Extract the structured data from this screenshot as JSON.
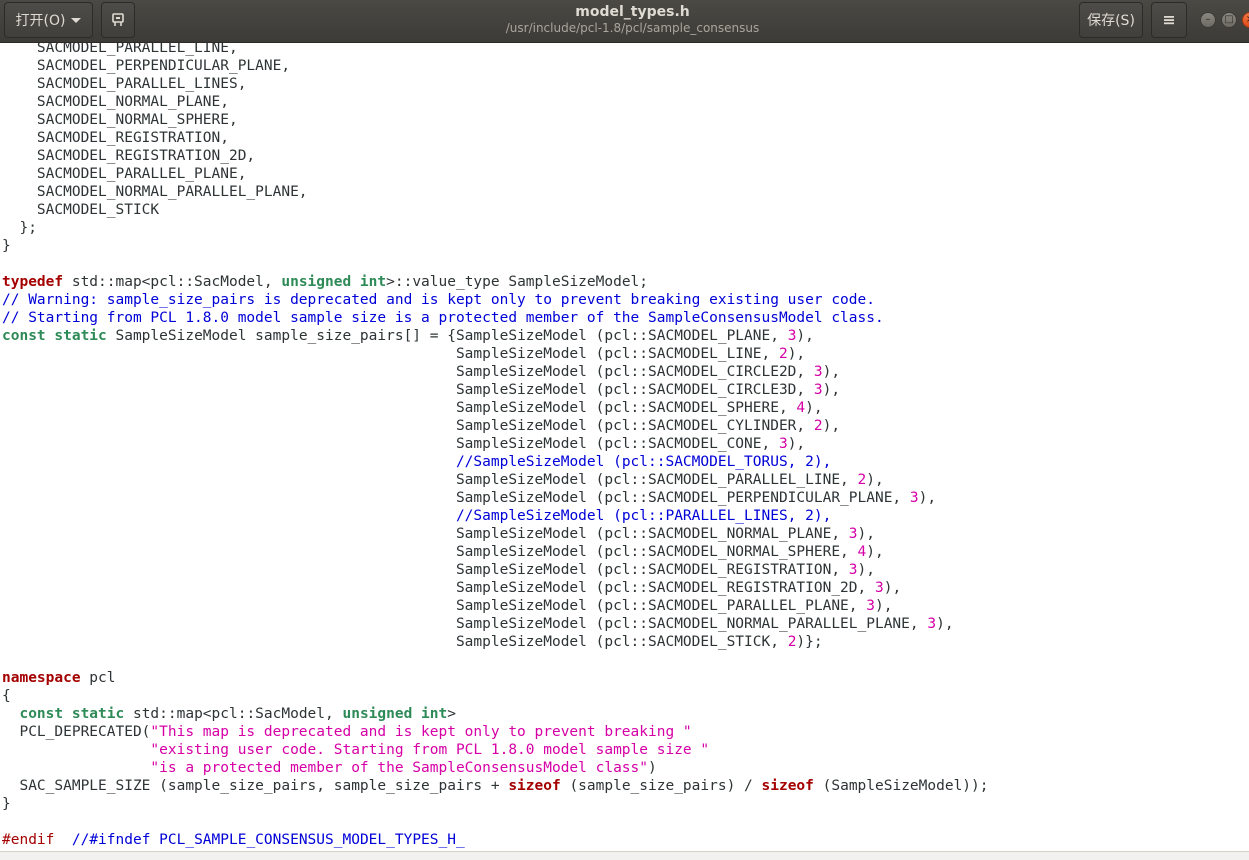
{
  "header": {
    "open_label": "打开(O)",
    "save_label": "保存(S)",
    "title": "model_types.h",
    "subtitle": "/usr/include/pcl-1.8/pcl/sample_consensus"
  },
  "colors": {
    "keyword": "#a40000",
    "type": "#2e8b57",
    "comment": "#0000d8",
    "string": "#d600a6",
    "text": "#2e3436",
    "headerbar": "#3c3b37"
  },
  "icons": {
    "open_dropdown": "chevron-down-icon",
    "pin": "pin-icon",
    "menu": "hamburger-menu-icon",
    "minimize": "minimize-icon",
    "maximize": "maximize-icon",
    "close": "close-icon"
  },
  "code_lines": [
    [
      [
        "",
        "    SACMODEL_PARALLEL_LINE,"
      ]
    ],
    [
      [
        "",
        "    SACMODEL_PERPENDICULAR_PLANE,"
      ]
    ],
    [
      [
        "",
        "    SACMODEL_PARALLEL_LINES,"
      ]
    ],
    [
      [
        "",
        "    SACMODEL_NORMAL_PLANE,"
      ]
    ],
    [
      [
        "",
        "    SACMODEL_NORMAL_SPHERE,"
      ]
    ],
    [
      [
        "",
        "    SACMODEL_REGISTRATION,"
      ]
    ],
    [
      [
        "",
        "    SACMODEL_REGISTRATION_2D,"
      ]
    ],
    [
      [
        "",
        "    SACMODEL_PARALLEL_PLANE,"
      ]
    ],
    [
      [
        "",
        "    SACMODEL_NORMAL_PARALLEL_PLANE,"
      ]
    ],
    [
      [
        "",
        "    SACMODEL_STICK"
      ]
    ],
    [
      [
        "",
        "  };"
      ]
    ],
    [
      [
        "",
        "}"
      ]
    ],
    [
      [
        "",
        ""
      ]
    ],
    [
      [
        "kw",
        "typedef"
      ],
      [
        "",
        " std::map<pcl::SacModel, "
      ],
      [
        "ty",
        "unsigned int"
      ],
      [
        "",
        ">::value_type SampleSizeModel;"
      ]
    ],
    [
      [
        "cm",
        "// Warning: sample_size_pairs is deprecated and is kept only to prevent breaking existing user code."
      ]
    ],
    [
      [
        "cm",
        "// Starting from PCL 1.8.0 model sample size is a protected member of the SampleConsensusModel class."
      ]
    ],
    [
      [
        "ty",
        "const static"
      ],
      [
        "",
        " SampleSizeModel sample_size_pairs[] = {SampleSizeModel (pcl::SACMODEL_PLANE, "
      ],
      [
        "nu",
        "3"
      ],
      [
        "",
        "),"
      ]
    ],
    [
      [
        "",
        "                                                    SampleSizeModel (pcl::SACMODEL_LINE, "
      ],
      [
        "nu",
        "2"
      ],
      [
        "",
        "),"
      ]
    ],
    [
      [
        "",
        "                                                    SampleSizeModel (pcl::SACMODEL_CIRCLE2D, "
      ],
      [
        "nu",
        "3"
      ],
      [
        "",
        "),"
      ]
    ],
    [
      [
        "",
        "                                                    SampleSizeModel (pcl::SACMODEL_CIRCLE3D, "
      ],
      [
        "nu",
        "3"
      ],
      [
        "",
        "),"
      ]
    ],
    [
      [
        "",
        "                                                    SampleSizeModel (pcl::SACMODEL_SPHERE, "
      ],
      [
        "nu",
        "4"
      ],
      [
        "",
        "),"
      ]
    ],
    [
      [
        "",
        "                                                    SampleSizeModel (pcl::SACMODEL_CYLINDER, "
      ],
      [
        "nu",
        "2"
      ],
      [
        "",
        "),"
      ]
    ],
    [
      [
        "",
        "                                                    SampleSizeModel (pcl::SACMODEL_CONE, "
      ],
      [
        "nu",
        "3"
      ],
      [
        "",
        "),"
      ]
    ],
    [
      [
        "",
        "                                                    "
      ],
      [
        "cm",
        "//SampleSizeModel (pcl::SACMODEL_TORUS, 2),"
      ]
    ],
    [
      [
        "",
        "                                                    SampleSizeModel (pcl::SACMODEL_PARALLEL_LINE, "
      ],
      [
        "nu",
        "2"
      ],
      [
        "",
        "),"
      ]
    ],
    [
      [
        "",
        "                                                    SampleSizeModel (pcl::SACMODEL_PERPENDICULAR_PLANE, "
      ],
      [
        "nu",
        "3"
      ],
      [
        "",
        "),"
      ]
    ],
    [
      [
        "",
        "                                                    "
      ],
      [
        "cm",
        "//SampleSizeModel (pcl::PARALLEL_LINES, 2),"
      ]
    ],
    [
      [
        "",
        "                                                    SampleSizeModel (pcl::SACMODEL_NORMAL_PLANE, "
      ],
      [
        "nu",
        "3"
      ],
      [
        "",
        "),"
      ]
    ],
    [
      [
        "",
        "                                                    SampleSizeModel (pcl::SACMODEL_NORMAL_SPHERE, "
      ],
      [
        "nu",
        "4"
      ],
      [
        "",
        "),"
      ]
    ],
    [
      [
        "",
        "                                                    SampleSizeModel (pcl::SACMODEL_REGISTRATION, "
      ],
      [
        "nu",
        "3"
      ],
      [
        "",
        "),"
      ]
    ],
    [
      [
        "",
        "                                                    SampleSizeModel (pcl::SACMODEL_REGISTRATION_2D, "
      ],
      [
        "nu",
        "3"
      ],
      [
        "",
        "),"
      ]
    ],
    [
      [
        "",
        "                                                    SampleSizeModel (pcl::SACMODEL_PARALLEL_PLANE, "
      ],
      [
        "nu",
        "3"
      ],
      [
        "",
        "),"
      ]
    ],
    [
      [
        "",
        "                                                    SampleSizeModel (pcl::SACMODEL_NORMAL_PARALLEL_PLANE, "
      ],
      [
        "nu",
        "3"
      ],
      [
        "",
        "),"
      ]
    ],
    [
      [
        "",
        "                                                    SampleSizeModel (pcl::SACMODEL_STICK, "
      ],
      [
        "nu",
        "2"
      ],
      [
        "",
        ")};"
      ]
    ],
    [
      [
        "",
        ""
      ]
    ],
    [
      [
        "kw",
        "namespace"
      ],
      [
        "",
        " pcl"
      ]
    ],
    [
      [
        "",
        "{"
      ]
    ],
    [
      [
        "",
        "  "
      ],
      [
        "ty",
        "const static"
      ],
      [
        "",
        " std::map<pcl::SacModel, "
      ],
      [
        "ty",
        "unsigned int"
      ],
      [
        "",
        ">"
      ]
    ],
    [
      [
        "",
        "  PCL_DEPRECATED("
      ],
      [
        "st",
        "\"This map is deprecated and is kept only to prevent breaking \""
      ]
    ],
    [
      [
        "",
        "                 "
      ],
      [
        "st",
        "\"existing user code. Starting from PCL 1.8.0 model sample size \""
      ]
    ],
    [
      [
        "",
        "                 "
      ],
      [
        "st",
        "\"is a protected member of the SampleConsensusModel class\""
      ],
      [
        "",
        ")"
      ]
    ],
    [
      [
        "",
        "  SAC_SAMPLE_SIZE (sample_size_pairs, sample_size_pairs + "
      ],
      [
        "kw",
        "sizeof"
      ],
      [
        "",
        " (sample_size_pairs) / "
      ],
      [
        "kw",
        "sizeof"
      ],
      [
        "",
        " (SampleSizeModel));"
      ]
    ],
    [
      [
        "",
        "}"
      ]
    ],
    [
      [
        "",
        ""
      ]
    ],
    [
      [
        "pp",
        "#endif"
      ],
      [
        "",
        "  "
      ],
      [
        "cm",
        "//#ifndef PCL_SAMPLE_CONSENSUS_MODEL_TYPES_H_"
      ]
    ]
  ]
}
